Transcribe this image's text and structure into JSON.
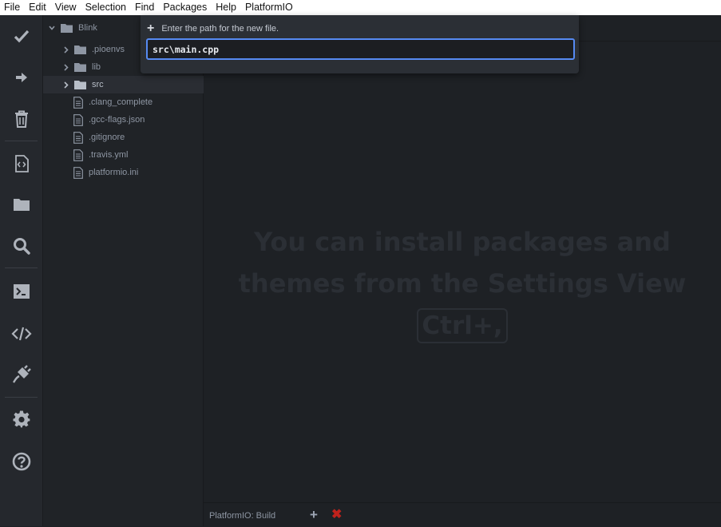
{
  "menu": [
    "File",
    "Edit",
    "View",
    "Selection",
    "Find",
    "Packages",
    "Help",
    "PlatformIO"
  ],
  "toolbar": {
    "icons": [
      "check-icon",
      "arrow-right-icon",
      "trash-icon",
      "code-file-icon",
      "folder-icon",
      "search-icon",
      "terminal-icon",
      "code-brackets-icon",
      "plug-icon",
      "gear-icon",
      "help-icon"
    ]
  },
  "tree": {
    "root": "Blink",
    "items": [
      {
        "label": ".pioenvs",
        "type": "folder"
      },
      {
        "label": "lib",
        "type": "folder"
      },
      {
        "label": "src",
        "type": "folder",
        "selected": true
      },
      {
        "label": ".clang_complete",
        "type": "file"
      },
      {
        "label": ".gcc-flags.json",
        "type": "file"
      },
      {
        "label": ".gitignore",
        "type": "file"
      },
      {
        "label": ".travis.yml",
        "type": "file"
      },
      {
        "label": "platformio.ini",
        "type": "file"
      }
    ]
  },
  "dialog": {
    "prompt": "Enter the path for the new file.",
    "value": "src\\main.cpp"
  },
  "welcome": {
    "line1": "You can install packages and",
    "line2": "themes from the Settings View",
    "shortcut": "Ctrl+,"
  },
  "statusbar": {
    "label": "PlatformIO: Build",
    "add": "+",
    "close": "✖"
  },
  "colors": {
    "accent": "#568af2",
    "close": "#c0221c"
  }
}
